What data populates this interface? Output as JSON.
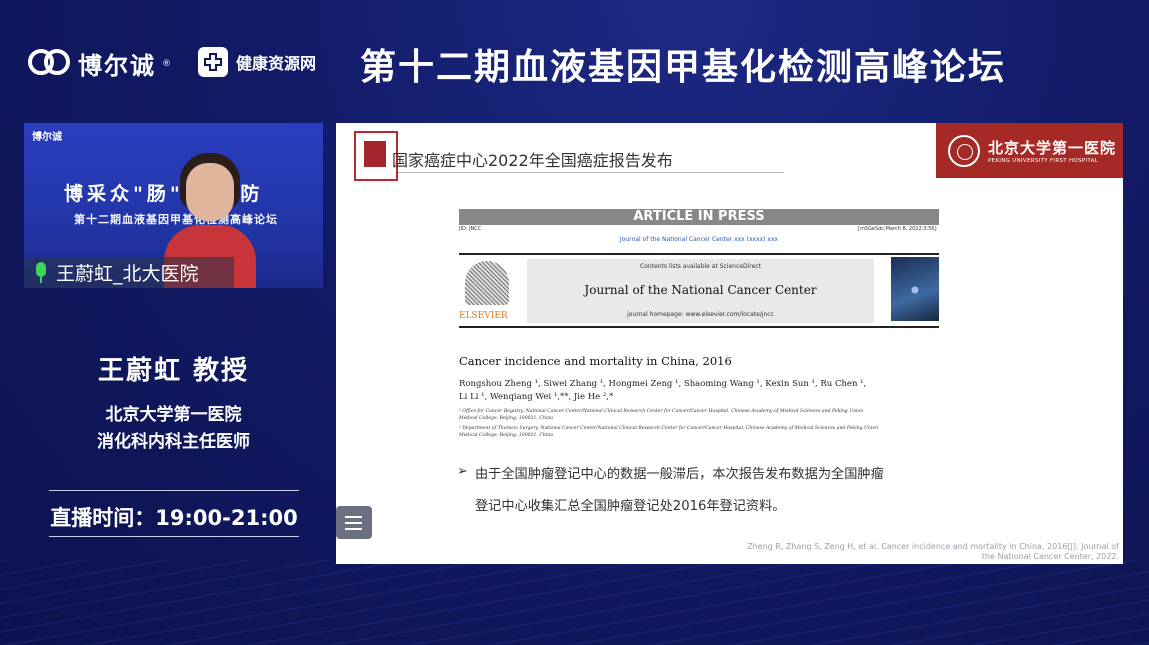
{
  "header": {
    "brand_logo": "博尔诚",
    "brand_reg": "®",
    "partner_logo": "健康资源网",
    "event_title": "第十二期血液基因甲基化检测高峰论坛"
  },
  "video": {
    "mini_logo": "博尔诚",
    "banner_line1": "博采众\"肠\"  癌先防",
    "banner_line2": "第十二期血液基因甲基化检测高峰论坛",
    "speaker_tag": "王蔚虹_北大医院",
    "mic_icon": "microphone-icon"
  },
  "speaker": {
    "name": "王蔚虹  教授",
    "affiliation_1": "北京大学第一医院",
    "affiliation_2": "消化科内科主任医师",
    "live_time": "直播时间：19:00-21:00"
  },
  "slide": {
    "title": "国家癌症中心2022年全国癌症报告发布",
    "hospital_cn": "北京大学第一医院",
    "hospital_en": "PEKING UNIVERSITY FIRST HOSPITAL",
    "article_banner": "ARTICLE IN PRESS",
    "id_left": "JID: JNCC",
    "id_right": "[m5GeSdc;March 8, 2022;3:56]",
    "journal_link": "Journal of the National Cancer Center xxx (xxxx) xxx",
    "contents_line": "Contents lists available at ScienceDirect",
    "journal_name": "Journal of the National Cancer Center",
    "journal_homepage": "journal homepage: www.elsevier.com/locate/jncc",
    "elsevier": "ELSEVIER",
    "paper_title": "Cancer incidence and mortality in China, 2016",
    "authors_line1": "Rongshou Zheng ¹, Siwei Zhang ¹, Hongmei Zeng ¹, Shaoming Wang ¹, Kexin Sun ¹, Ru Chen ¹,",
    "authors_line2": "Li Li ¹, Wenqiang Wei ¹,**, Jie He ²,*",
    "affil_1": "¹ Office for Cancer Registry, National Cancer Center/National Clinical Research Center for Cancer/Cancer Hospital, Chinese Academy of Medical Sciences and Peking Union Medical College, Beijing, 100021, China",
    "affil_2": "² Department of Thoracic Surgery, National Cancer Center/National Clinical Research Center for Cancer/Cancer Hospital, Chinese Academy of Medical Sciences and Peking Union Medical College, Beijing, 100021, China",
    "bullet_line1": "由于全国肿瘤登记中心的数据一般滞后，本次报告发布数据为全国肿瘤",
    "bullet_line2": "登记中心收集汇总全国肿瘤登记处2016年登记资料。",
    "citation_line1": "Zheng R, Zhang S, Zeng H, et al. Cancer incidence and mortality in China, 2016[J]. Journal of",
    "citation_line2": "the National Cancer Center, 2022."
  },
  "controls": {
    "list_icon": "list-menu-icon"
  }
}
